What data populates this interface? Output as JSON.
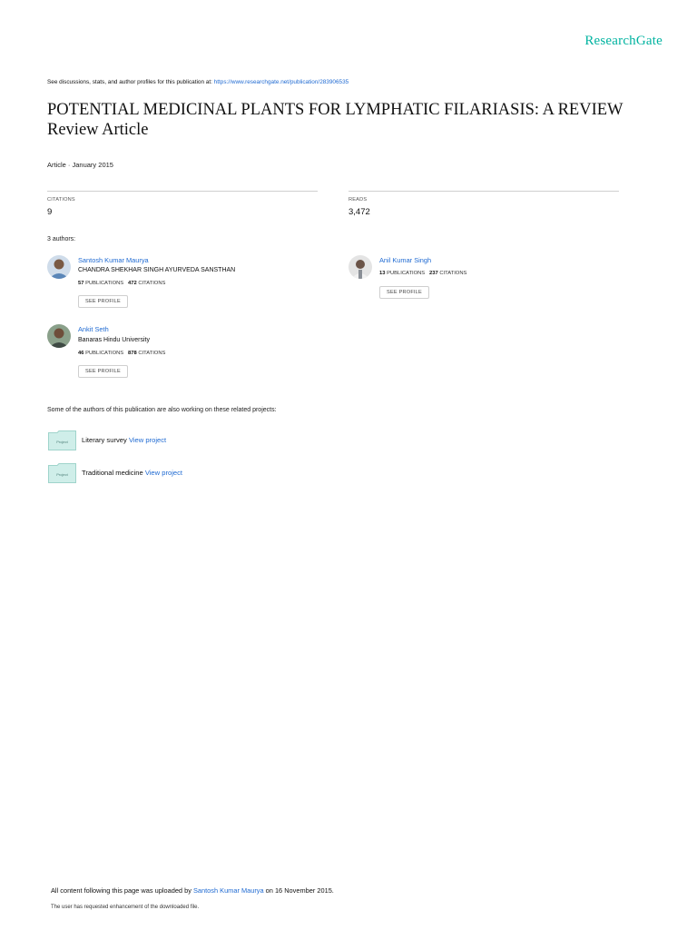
{
  "brand": "ResearchGate",
  "discussion": {
    "prefix": "See discussions, stats, and author profiles for this publication at:",
    "url": "https://www.researchgate.net/publication/283906535"
  },
  "title_line1": "POTENTIAL MEDICINAL PLANTS FOR LYMPHATIC FILARIASIS: A REVIEW",
  "title_line2": "Review Article",
  "meta": "Article · January 2015",
  "stats": {
    "citations_label": "CITATIONS",
    "citations_value": "9",
    "reads_label": "READS",
    "reads_value": "3,472"
  },
  "authors_heading": "3 authors:",
  "authors": [
    {
      "name": "Santosh Kumar Maurya",
      "affiliation": "CHANDRA SHEKHAR SINGH AYURVEDA SANSTHAN",
      "publications": "57",
      "publications_label": "PUBLICATIONS",
      "citations": "472",
      "citations_label": "CITATIONS",
      "button": "SEE PROFILE",
      "avatar_color": "#5a86b8"
    },
    {
      "name": "Anil Kumar Singh",
      "affiliation": "",
      "publications": "13",
      "publications_label": "PUBLICATIONS",
      "citations": "237",
      "citations_label": "CITATIONS",
      "button": "SEE PROFILE",
      "avatar_color": "#8a8f96"
    },
    {
      "name": "Ankit Seth",
      "affiliation": "Banaras Hindu University",
      "publications": "46",
      "publications_label": "PUBLICATIONS",
      "citations": "878",
      "citations_label": "CITATIONS",
      "button": "SEE PROFILE",
      "avatar_color": "#4b5a4a"
    }
  ],
  "related_heading": "Some of the authors of this publication are also working on these related projects:",
  "projects": [
    {
      "icon_label": "Project",
      "name": "Literary survey",
      "link": "View project"
    },
    {
      "icon_label": "Project",
      "name": "Traditional medicine",
      "link": "View project"
    }
  ],
  "footer": {
    "prefix": "All content following this page was uploaded by",
    "uploader": "Santosh Kumar Maurya",
    "suffix": "on 16 November 2015.",
    "note": "The user has requested enhancement of the downloaded file."
  },
  "colors": {
    "brand": "#00b3a0",
    "link": "#1f6ad2",
    "project_icon": "#cfeee9"
  }
}
